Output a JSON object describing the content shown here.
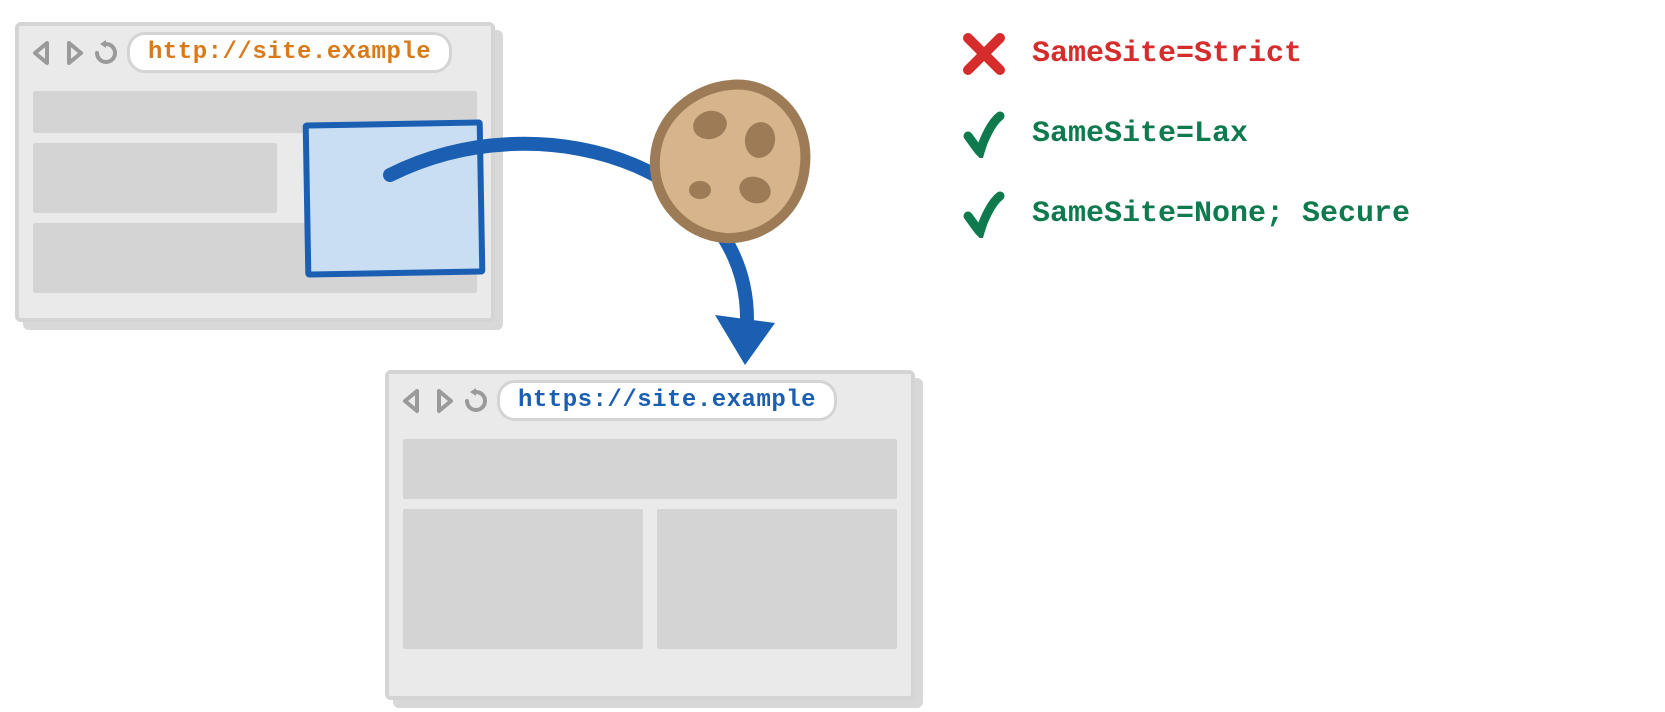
{
  "browser1": {
    "url": "http://site.example"
  },
  "browser2": {
    "url": "https://site.example"
  },
  "legend": {
    "items": [
      {
        "status": "blocked",
        "text": "SameSite=Strict"
      },
      {
        "status": "allowed",
        "text": "SameSite=Lax"
      },
      {
        "status": "allowed",
        "text": "SameSite=None; Secure"
      }
    ]
  }
}
